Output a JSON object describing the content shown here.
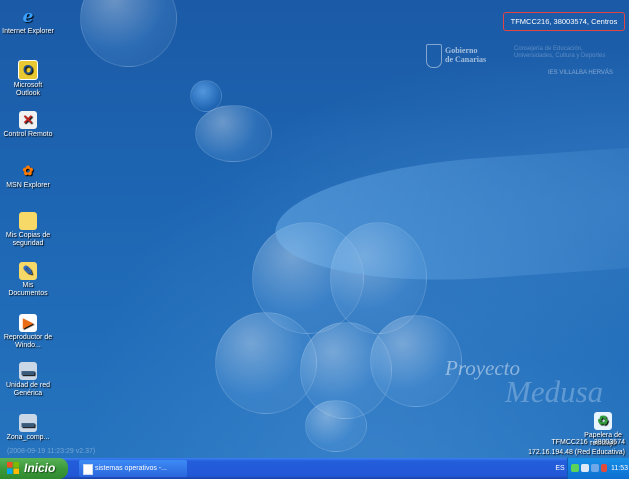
{
  "desktop": {
    "icons": [
      {
        "label": "Internet Explorer",
        "glyph": "e",
        "icon": "internet-explorer-icon"
      },
      {
        "label": "Microsoft Outlook",
        "glyph": "O",
        "icon": "outlook-icon"
      },
      {
        "label": "Control Remoto",
        "glyph": "✕",
        "icon": "remote-control-icon"
      },
      {
        "label": "MSN Explorer",
        "glyph": "✿",
        "icon": "msn-butterfly-icon"
      },
      {
        "label": "Mis Copias de seguridad",
        "glyph": "",
        "icon": "backup-folder-icon"
      },
      {
        "label": "Mis Documentos",
        "glyph": "✎",
        "icon": "my-documents-icon"
      },
      {
        "label": "Reproductor de Windo...",
        "glyph": "▶",
        "icon": "media-player-icon"
      },
      {
        "label": "Unidad de red Genérica",
        "glyph": "▬",
        "icon": "network-drive-icon"
      },
      {
        "label": "Zona_comp...",
        "glyph": "▬",
        "icon": "shared-zone-drive-icon"
      }
    ],
    "recycle_bin": {
      "label": "Papelera de reciclaje",
      "glyph": "♻",
      "icon": "recycle-bin-icon"
    },
    "info_badge": "TFMCC216, 38003574, Centros",
    "government_name": "Gobierno\nde Canarias",
    "consejeria": "Consejería de Educación,\nUniversidades, Cultura y Deportes",
    "school": "IES VILLALBA HERVÁS",
    "branding": {
      "line1": "Proyecto",
      "line2": "Medusa"
    },
    "timestamp": "(2008-09-19 11:23:29 v2.37)",
    "host_info": {
      "line1": "TFMCC216 - 38003574",
      "line2": "172.16.194.48 (Red Educativa)"
    }
  },
  "taskbar": {
    "start_label": "Inicio",
    "window_label": "sistemas operativos -...",
    "language": "ES",
    "clock": "11:53"
  },
  "colors": {
    "desktop_blue": "#1d66b3",
    "taskbar_blue": "#245edb",
    "start_green": "#3c9a3b",
    "badge_border": "#e24444",
    "tray_blue": "#1790e8"
  }
}
